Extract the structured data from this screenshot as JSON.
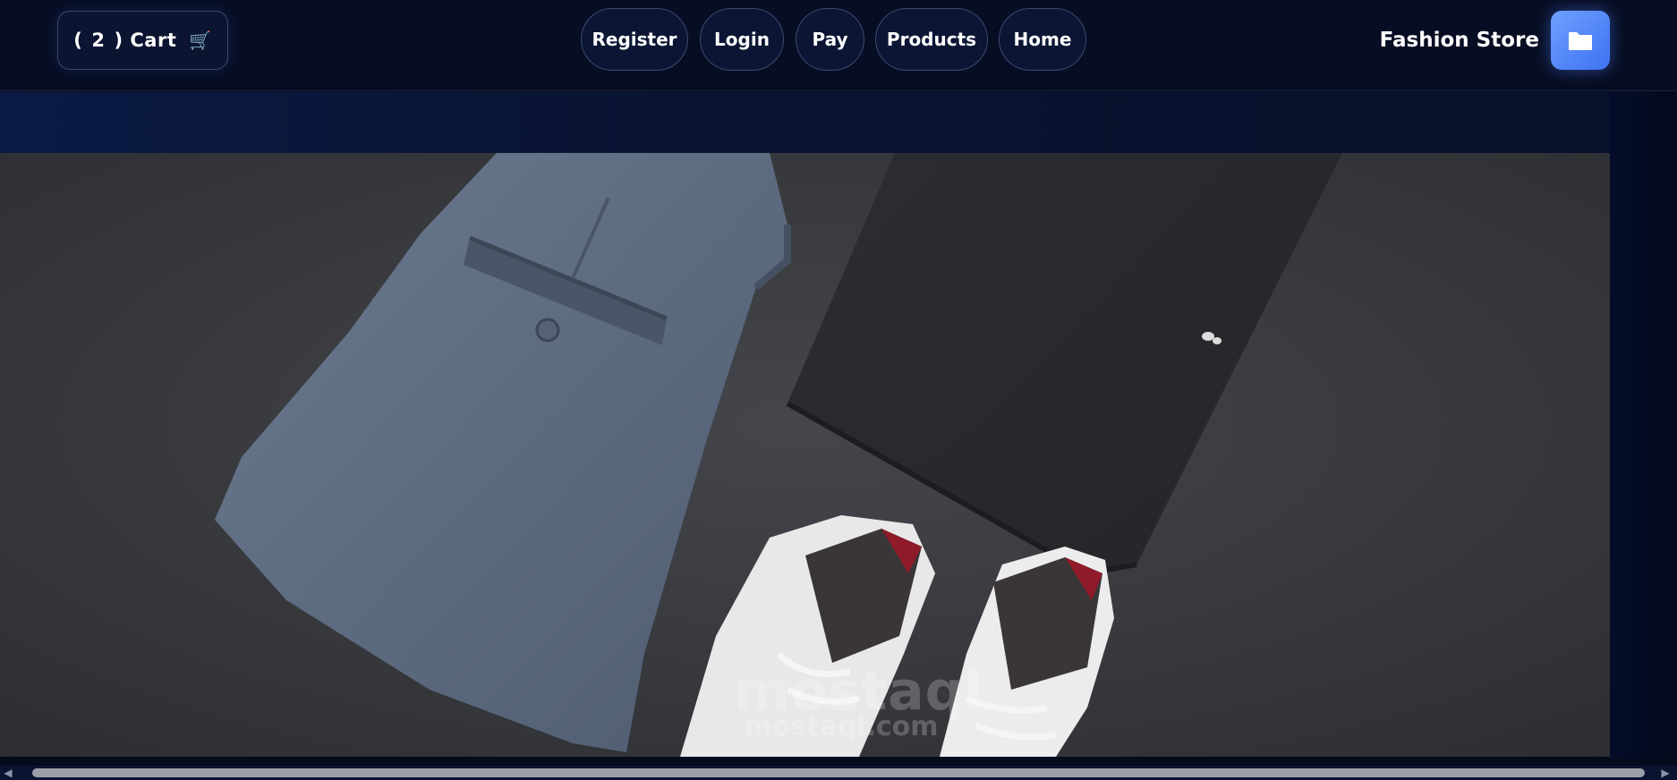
{
  "header": {
    "cart": {
      "open_paren": "(",
      "count": "2",
      "close_label": ") Cart",
      "icon": "cart-icon",
      "icon_glyph": "🛒"
    },
    "nav": [
      {
        "label": "Register"
      },
      {
        "label": "Login"
      },
      {
        "label": "Pay"
      },
      {
        "label": "Products"
      },
      {
        "label": "Home"
      }
    ],
    "brand": "Fashion Store",
    "logo_icon": "folder-icon"
  },
  "hero": {
    "image": "folded-trousers-shirt-and-sneakers-photo",
    "watermark": {
      "main": "mostaql",
      "sub": "mostaql.com"
    }
  },
  "colors": {
    "background": "#050a1c",
    "accent": "#4d82f5",
    "pill_border": "#3a4a72"
  }
}
